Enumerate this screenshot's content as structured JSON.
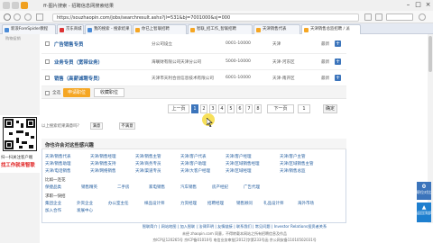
{
  "window": {
    "title": "ff-图片搜索 - 招聘信息网搜索结果",
    "buttons": [
      "–",
      "□",
      "×"
    ]
  },
  "toolbar": {
    "url": "https://souzhaopin.com/jobs/searchresult.ashx?jl=531&bj=7001000&sj=000",
    "tabs": [
      {
        "label": "新浪ForeSpider教程"
      },
      {
        "label": "京东商城"
      },
      {
        "label": "我的搜索 - 搜索结果"
      },
      {
        "label": "你已上智联招聘"
      },
      {
        "label": "智联_招工作_智联招聘"
      },
      {
        "label": "天津销售代表"
      },
      {
        "label": "天津销售总监招聘 / 派"
      }
    ]
  },
  "left_panel": {
    "label": "购物促销"
  },
  "jobs": [
    {
      "title": "广告销售专员",
      "company": "分公司设立",
      "salary": "0001-10000",
      "location": "天津",
      "date": "最新"
    },
    {
      "title": "业务专员（宽带业务）",
      "company": "海联财有限公司天津分公司",
      "salary": "5000-10000",
      "location": "天津-河东区",
      "date": "最新"
    },
    {
      "title": "销售（高薪诚聘专员）",
      "company": "天津市天利合创信息技术有限公司",
      "salary": "6001-10000",
      "location": "天津-南开区",
      "date": "最新"
    }
  ],
  "actions": {
    "select_all": "全选",
    "apply": "申请职位",
    "favorite": "收藏职位"
  },
  "pagination": {
    "prev": "上一页",
    "pages": [
      "1",
      "2",
      "3",
      "4",
      "5",
      "6",
      "7",
      "8"
    ],
    "current": "1",
    "next": "下一页",
    "goto_value": "1",
    "goto_label": "确定"
  },
  "feedback": {
    "question": "以上搜索结果满意吗？",
    "yes": "满意",
    "no": "不满意"
  },
  "recommend": {
    "title": "你也许会对这些感兴趣",
    "rows": [
      [
        "天津/销售代表",
        "天津/销售经理",
        "天津/销售主管",
        "天津/客户代表",
        "天津/客户经理",
        "天津/客户主管"
      ],
      [
        "天津/销售助理",
        "天津/销售支持",
        "天津/商务专员",
        "天津/客户助理",
        "天津/区域销售经理",
        "天津/区域销售主管"
      ],
      [
        "天津/电话销售",
        "天津/网络销售",
        "天津/渠道专员",
        "天津/大客户经理",
        "天津/区域经理",
        "天津/销售总监"
      ]
    ],
    "section2_label": "比如一连花",
    "section2_items": [
      "保捷品类",
      "销售精英",
      "二手房",
      "家电销售",
      "汽车销售",
      "房产经纪",
      "广告代理"
    ],
    "section3_label": "求职一快招",
    "section3_items": [
      "集团企业",
      "外资企业",
      "办公室主任",
      "样品设计师",
      "力资经理",
      "招聘经理",
      "销售顾问",
      "礼品设计师",
      "海外市场"
    ],
    "section3_extra": [
      "加入合作",
      "发展中心"
    ]
  },
  "qr": {
    "caption1": "扫一扫关注客户端",
    "caption2": "找工作就来智联"
  },
  "side": {
    "count": "0",
    "count_label": "职位对比",
    "top_label": "返回顶部"
  },
  "footer": {
    "links": "智联简介 | 网站地图 | 加入智联 | 法律声明 | 友情链接 | 联系我们 | 常见问题 | Investor Relations投资者关系",
    "line2": "未经 zhaopin.com 同意，不得转载本网站之所有招聘信息及作品",
    "line3": "京ICP证120265号 京ICP备01010号 电信业务审批[2012]字第233号函 京公网安备11010502031号"
  }
}
